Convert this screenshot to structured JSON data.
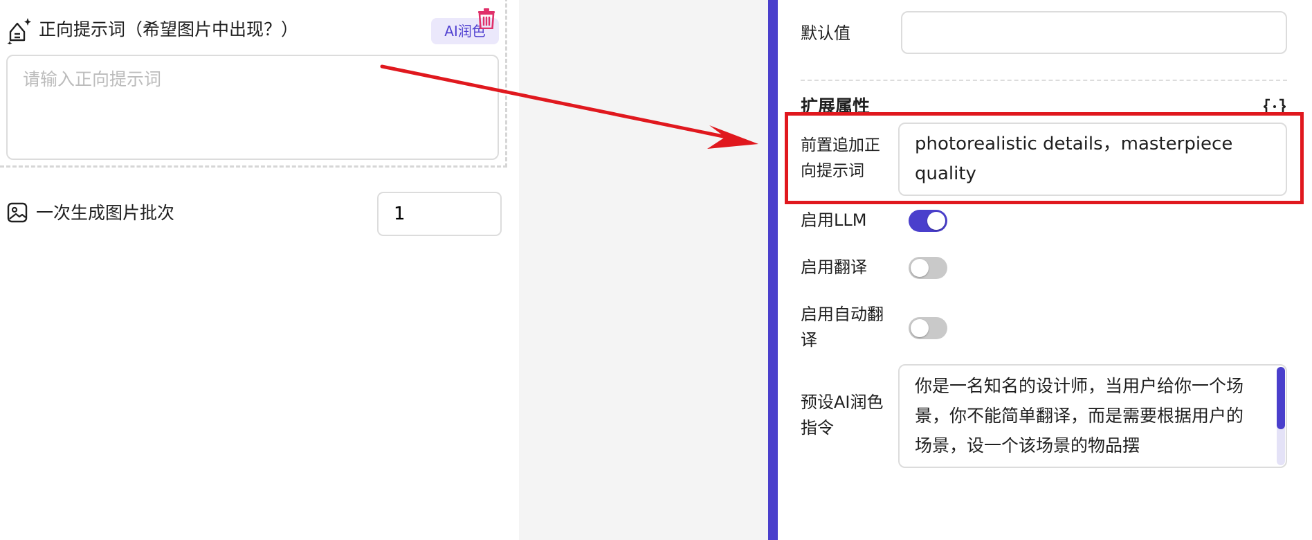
{
  "left": {
    "prompt_title": "正向提示词（希望图片中出现？）",
    "ai_polish_label": "AI润色",
    "prompt_placeholder": "请输入正向提示词",
    "batch_label": "一次生成图片批次",
    "batch_value": "1"
  },
  "right": {
    "default_label": "默认值",
    "default_value": "",
    "ext_title": "扩展属性",
    "prefix_label": "前置追加正向提示词",
    "prefix_value": "photorealistic details，masterpiece quality",
    "llm_label": "启用LLM",
    "llm_enabled": true,
    "translate_label": "启用翻译",
    "translate_enabled": false,
    "autotranslate_label": "启用自动翻译",
    "autotranslate_enabled": false,
    "preset_label": "预设AI润色指令",
    "preset_value": "你是一名知名的设计师，当用户给你一个场景，你不能简单翻译，而是需要根据用户的场景，设一个该场景的物品摆"
  },
  "colors": {
    "accent": "#4a3fcc",
    "highlight": "#e0181e",
    "delete": "#e0306a"
  },
  "icons": [
    "sparkle-prompt-icon",
    "trash-icon",
    "image-icon",
    "code-bracket-icon",
    "arrow"
  ]
}
